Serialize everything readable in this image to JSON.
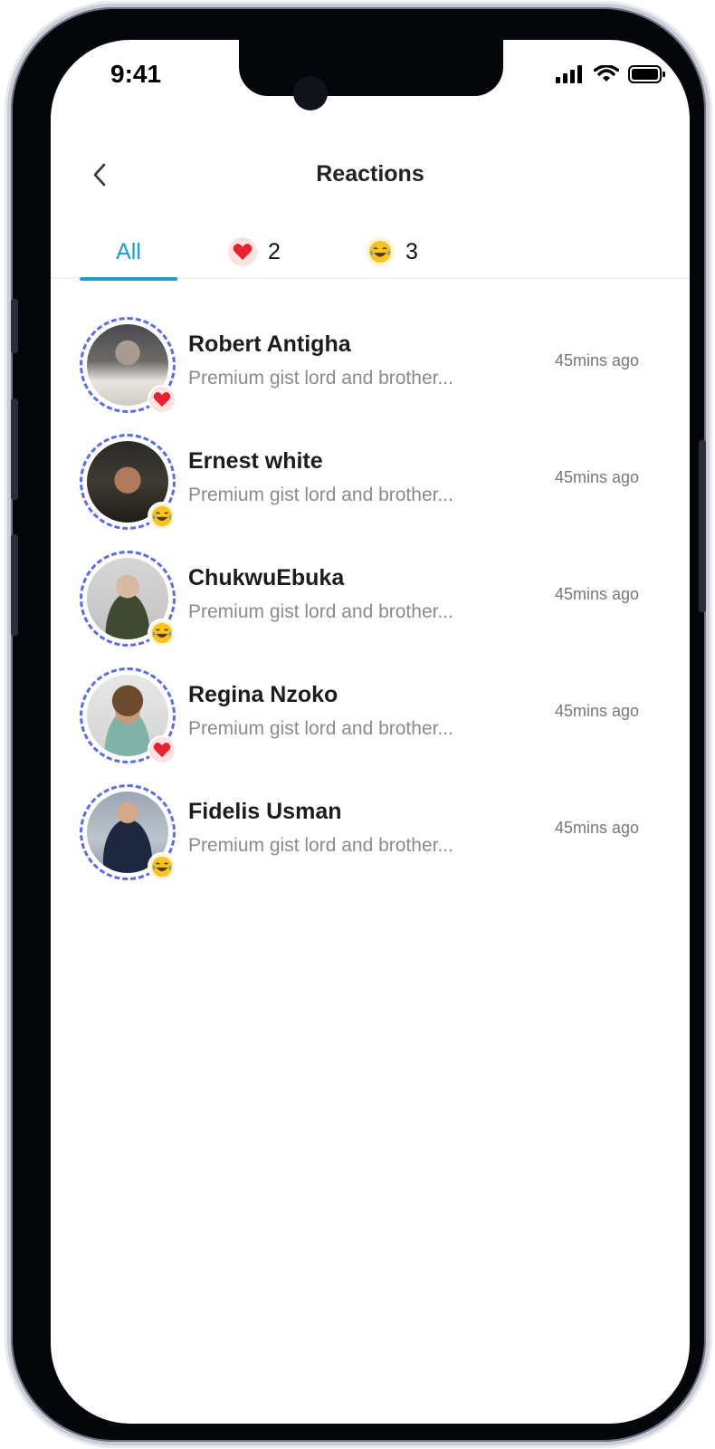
{
  "status_bar": {
    "time": "9:41"
  },
  "header": {
    "title": "Reactions"
  },
  "tabs": [
    {
      "label": "All"
    },
    {
      "icon": "heart-icon",
      "count": "2"
    },
    {
      "icon": "laughing-emoji-icon",
      "count": "3"
    }
  ],
  "colors": {
    "accent": "#1e9ec7",
    "ring": "#5b6de0",
    "heart": "#e8232f",
    "laugh": "#f7c325"
  },
  "reactions": [
    {
      "name": "Robert Antigha",
      "message": "Premium gist lord and brother...",
      "time": "45mins ago",
      "reaction": "heart-icon"
    },
    {
      "name": "Ernest white",
      "message": "Premium gist lord and brother...",
      "time": "45mins ago",
      "reaction": "laughing-emoji-icon"
    },
    {
      "name": "ChukwuEbuka",
      "message": "Premium gist lord and brother...",
      "time": "45mins ago",
      "reaction": "laughing-emoji-icon"
    },
    {
      "name": "Regina Nzoko",
      "message": "Premium gist lord and brother...",
      "time": "45mins ago",
      "reaction": "heart-icon"
    },
    {
      "name": "Fidelis Usman",
      "message": "Premium gist lord and brother...",
      "time": "45mins ago",
      "reaction": "laughing-emoji-icon"
    }
  ]
}
